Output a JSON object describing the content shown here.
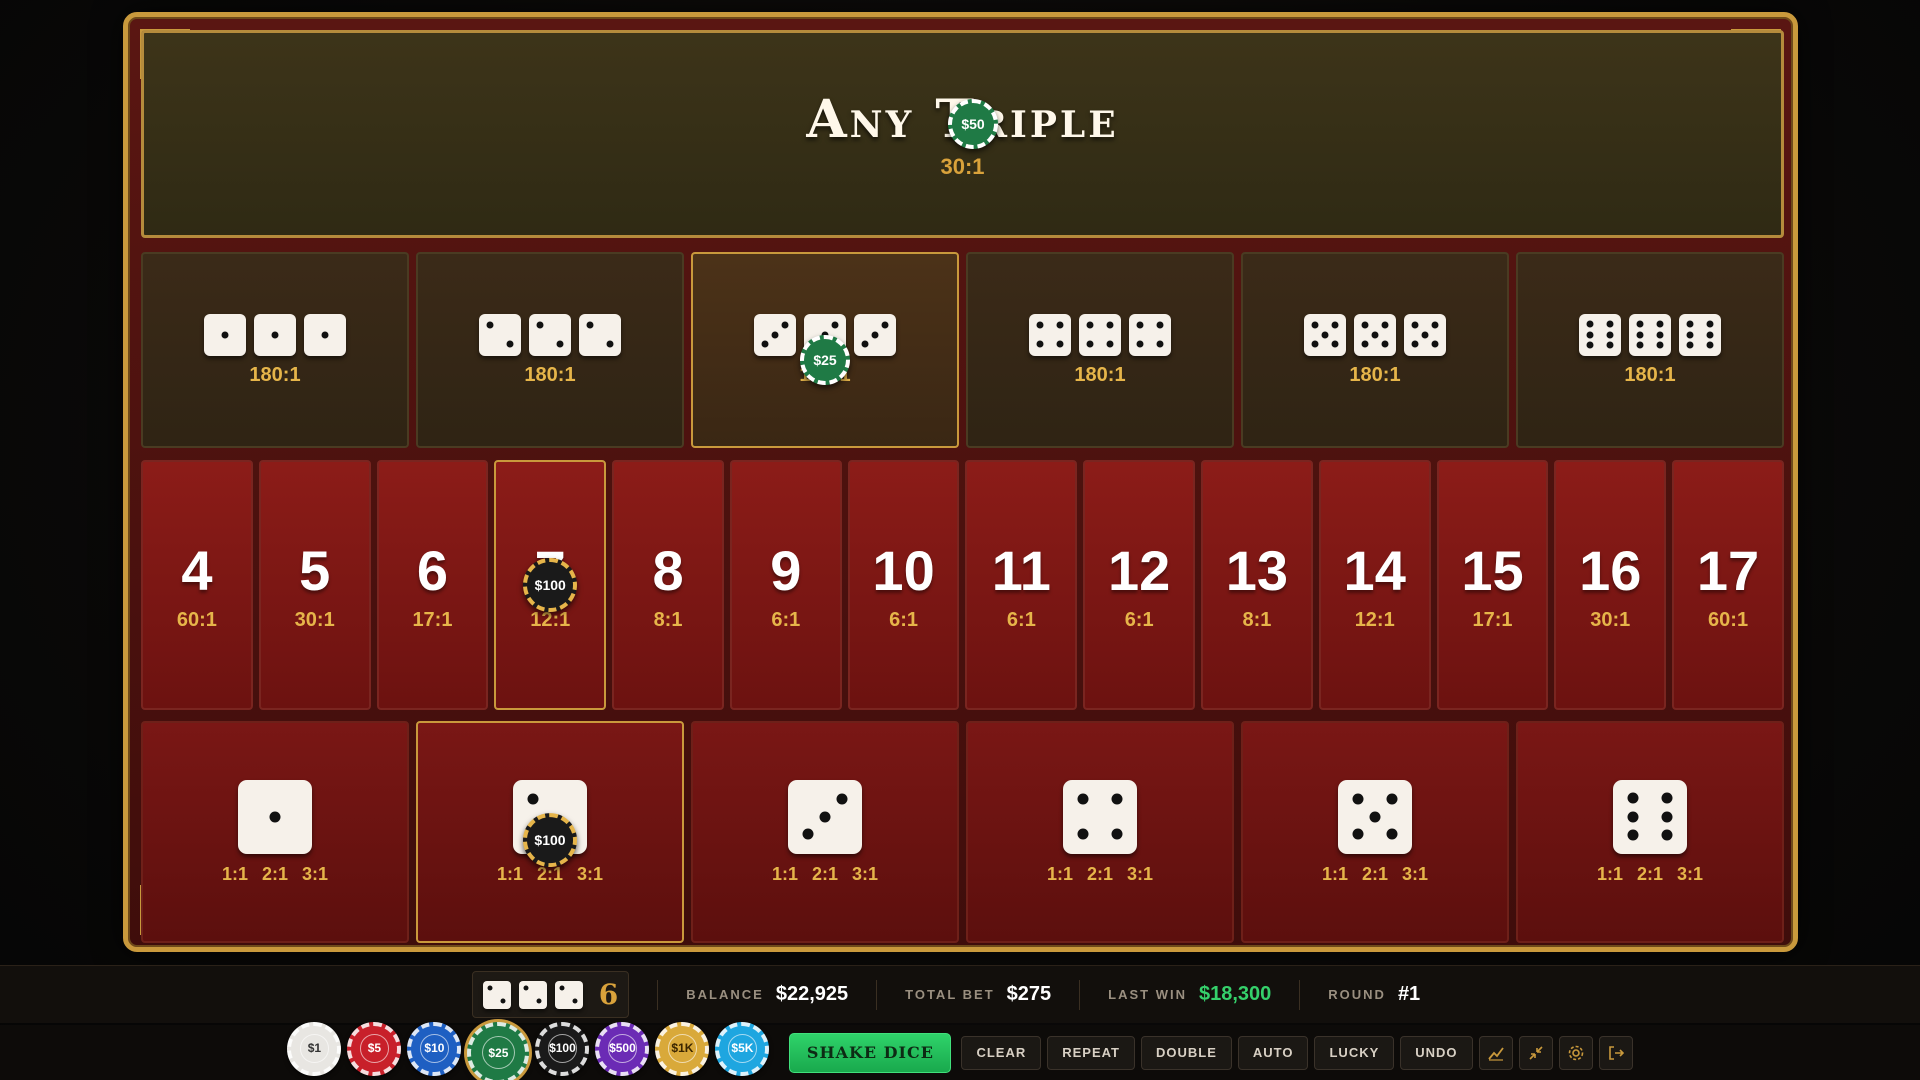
{
  "any_triple": {
    "title": "Any Triple",
    "odds": "30:1",
    "chip": "$50"
  },
  "triples": [
    {
      "face": 1,
      "odds": "180:1"
    },
    {
      "face": 2,
      "odds": "180:1"
    },
    {
      "face": 3,
      "odds": "180:1",
      "chip": "$25"
    },
    {
      "face": 4,
      "odds": "180:1"
    },
    {
      "face": 5,
      "odds": "180:1"
    },
    {
      "face": 6,
      "odds": "180:1"
    }
  ],
  "totals": [
    {
      "num": "4",
      "odds": "60:1"
    },
    {
      "num": "5",
      "odds": "30:1"
    },
    {
      "num": "6",
      "odds": "17:1"
    },
    {
      "num": "7",
      "odds": "12:1",
      "chip": "$100"
    },
    {
      "num": "8",
      "odds": "8:1"
    },
    {
      "num": "9",
      "odds": "6:1"
    },
    {
      "num": "10",
      "odds": "6:1"
    },
    {
      "num": "11",
      "odds": "6:1"
    },
    {
      "num": "12",
      "odds": "6:1"
    },
    {
      "num": "13",
      "odds": "8:1"
    },
    {
      "num": "14",
      "odds": "12:1"
    },
    {
      "num": "15",
      "odds": "17:1"
    },
    {
      "num": "16",
      "odds": "30:1"
    },
    {
      "num": "17",
      "odds": "60:1"
    }
  ],
  "singles": [
    {
      "face": 1,
      "pays": [
        "1:1",
        "2:1",
        "3:1"
      ]
    },
    {
      "face": 2,
      "pays": [
        "1:1",
        "2:1",
        "3:1"
      ],
      "chip": "$100"
    },
    {
      "face": 3,
      "pays": [
        "1:1",
        "2:1",
        "3:1"
      ]
    },
    {
      "face": 4,
      "pays": [
        "1:1",
        "2:1",
        "3:1"
      ]
    },
    {
      "face": 5,
      "pays": [
        "1:1",
        "2:1",
        "3:1"
      ]
    },
    {
      "face": 6,
      "pays": [
        "1:1",
        "2:1",
        "3:1"
      ]
    }
  ],
  "status": {
    "last_roll": [
      2,
      2,
      2
    ],
    "sum": "6",
    "balance_label": "BALANCE",
    "balance": "$22,925",
    "total_bet_label": "TOTAL BET",
    "total_bet": "$275",
    "last_win_label": "LAST WIN",
    "last_win": "$18,300",
    "round_label": "ROUND",
    "round": "#1"
  },
  "chips": [
    {
      "label": "$1",
      "color": "#e8e6e2",
      "text": "#333"
    },
    {
      "label": "$5",
      "color": "#c8202a",
      "text": "#fff"
    },
    {
      "label": "$10",
      "color": "#1e5fc2",
      "text": "#fff"
    },
    {
      "label": "$25",
      "color": "#1f7a45",
      "text": "#fff",
      "selected": true
    },
    {
      "label": "$100",
      "color": "#1a1a1a",
      "text": "#fff"
    },
    {
      "label": "$500",
      "color": "#6b2bb5",
      "text": "#fff"
    },
    {
      "label": "$1K",
      "color": "#d9a93a",
      "text": "#3a2500"
    },
    {
      "label": "$5K",
      "color": "#1ea6e0",
      "text": "#fff"
    }
  ],
  "buttons": {
    "shake": "SHAKE DICE",
    "clear": "CLEAR",
    "repeat": "REPEAT",
    "double": "DOUBLE",
    "auto": "AUTO",
    "lucky": "LUCKY",
    "undo": "UNDO"
  },
  "icons": [
    "stats-icon",
    "collapse-icon",
    "gear-icon",
    "exit-icon"
  ],
  "colors": {
    "gold": "#c9993c",
    "felt_red": "#8c1c18",
    "odds_gold": "#e6b54a",
    "win_green": "#35d06b"
  }
}
